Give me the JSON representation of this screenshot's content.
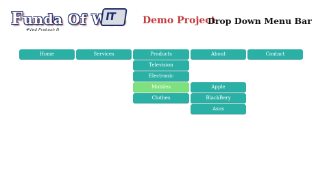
{
  "logo": {
    "text_first": "F",
    "text_rest": "unda Of Web",
    "byline": "#Ved Prakash N",
    "icon_text": "IT"
  },
  "header": {
    "demo_title": "Demo Project",
    "menu_title": "Drop Down Menu Bar"
  },
  "menu": {
    "home": "Home",
    "services": "Services",
    "products": "Products",
    "about": "About",
    "contact": "Contact"
  },
  "products_submenu": {
    "television": "Television",
    "electronic": "Electronic",
    "mobiles": "Mobiles",
    "clothes": "Clothes"
  },
  "mobiles_submenu": {
    "apple": "Apple",
    "blackberry": "BlackBery",
    "asus": "Asus"
  },
  "colors": {
    "menu_bg": "#2bb0a6",
    "active_bg": "#7fe07f",
    "demo_title": "#c23a3a"
  }
}
